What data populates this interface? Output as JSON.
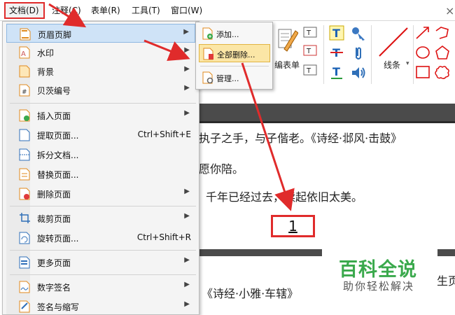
{
  "menubar": {
    "items": [
      {
        "label": "文档(D)"
      },
      {
        "label": "注释(C)"
      },
      {
        "label": "表单(R)"
      },
      {
        "label": "工具(T)"
      },
      {
        "label": "窗口(W)"
      }
    ],
    "close_glyph": "×"
  },
  "ribbon": {
    "form_group_label": "编表单",
    "shape_group_label": "线条"
  },
  "document": {
    "lines": [
      "执子之手，与子偕老。《诗经·邶风·击鼓》",
      "愿你陪。",
      "千年已经过去，读起依旧太美。",
      "《诗经·小雅·车辖》",
      "生页"
    ],
    "page_number": "1"
  },
  "file_menu": {
    "items": [
      {
        "label": "页眉页脚",
        "icon": "header-footer-icon",
        "submenu": true
      },
      {
        "label": "水印",
        "icon": "watermark-icon",
        "submenu": true
      },
      {
        "label": "背景",
        "icon": "background-icon",
        "submenu": true
      },
      {
        "label": "贝茨编号",
        "icon": "bates-number-icon",
        "submenu": true
      },
      {
        "label": "插入页面",
        "icon": "insert-page-icon",
        "submenu": true
      },
      {
        "label": "提取页面...",
        "icon": "extract-page-icon",
        "shortcut": "Ctrl+Shift+E"
      },
      {
        "label": "拆分文档...",
        "icon": "split-document-icon"
      },
      {
        "label": "替换页面...",
        "icon": "replace-page-icon"
      },
      {
        "label": "删除页面",
        "icon": "delete-page-icon",
        "submenu": true
      },
      {
        "label": "裁剪页面",
        "icon": "crop-page-icon",
        "submenu": true
      },
      {
        "label": "旋转页面...",
        "icon": "rotate-page-icon",
        "shortcut": "Ctrl+Shift+R"
      },
      {
        "label": "更多页面",
        "icon": "more-pages-icon",
        "submenu": true
      },
      {
        "label": "数字签名",
        "icon": "digital-signature-icon",
        "submenu": true
      },
      {
        "label": "签名与缩写",
        "icon": "sign-initials-icon",
        "submenu": true
      }
    ]
  },
  "header_footer_submenu": {
    "items": [
      {
        "label": "添加...",
        "icon": "add-header-icon"
      },
      {
        "label": "全部删除...",
        "icon": "delete-all-header-icon"
      },
      {
        "label": "管理...",
        "icon": "manage-header-icon"
      }
    ]
  },
  "watermark": {
    "title": "百科全说",
    "subtitle": "助你轻松解决"
  },
  "colors": {
    "annotation_red": "#e02b2b",
    "menu_highlight": "#cfe3f7",
    "submenu_highlight": "#fbe6a6",
    "watermark_green": "#3aa94c"
  }
}
